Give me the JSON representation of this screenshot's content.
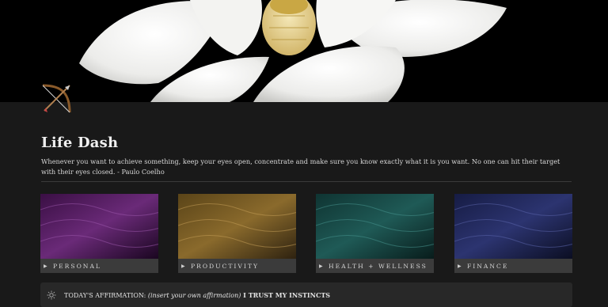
{
  "page": {
    "title": "Life Dash",
    "quote": "Whenever you want to achieve something, keep your eyes open, concentrate and make sure you know exactly what it is you want. No one can hit their target with their eyes closed.  - Paulo Coelho",
    "icon": "archer-bow-icon"
  },
  "cards": [
    {
      "label": "PERSONAL",
      "color": "#6a2a78"
    },
    {
      "label": "PRODUCTIVITY",
      "color": "#8a6a2c"
    },
    {
      "label": "HEALTH + WELLNESS",
      "color": "#1f5a56"
    },
    {
      "label": "FINANCE",
      "color": "#2c3470"
    }
  ],
  "affirmation": {
    "prefix": "TODAY'S AFFIRMATION: ",
    "italic": "(insert your own affirmation)",
    "bold": " I TRUST MY INSTINCTS"
  }
}
